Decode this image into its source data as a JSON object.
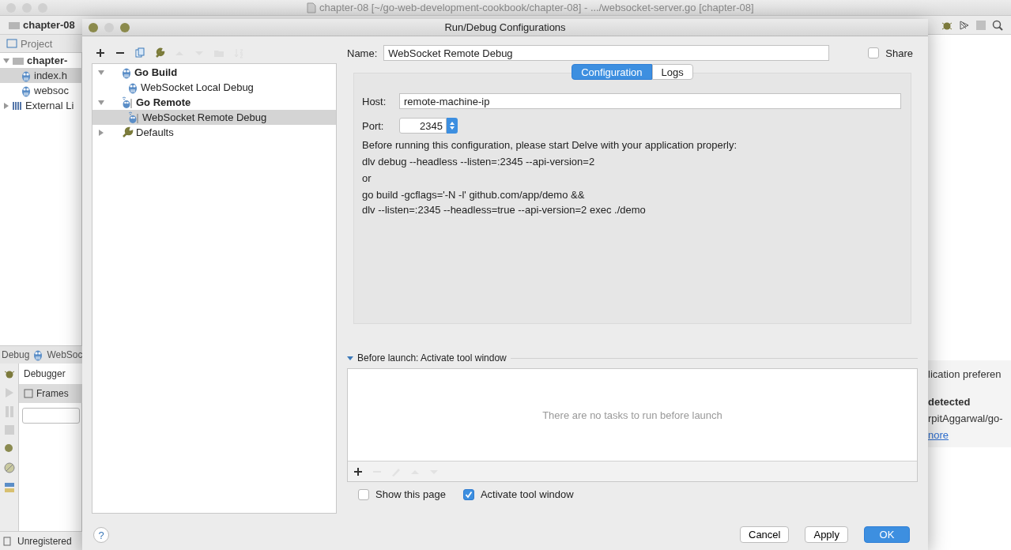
{
  "app_window": {
    "title": "chapter-08 [~/go-web-development-cookbook/chapter-08] - .../websocket-server.go [chapter-08]",
    "breadcrumb": "chapter-08",
    "project_tab": "Project",
    "project_tree": [
      {
        "label": "chapter-",
        "expanded": true,
        "children": [
          {
            "label": "index.h",
            "selected": true
          },
          {
            "label": "websoc",
            "selected": false
          }
        ]
      },
      {
        "label": "External Li",
        "expanded": false
      }
    ],
    "debug_panel": {
      "title": "Debug",
      "session": "WebSoc",
      "tab": "Debugger",
      "frames_label": "Frames"
    },
    "status_bar": "Unregistered",
    "notification": {
      "line_1": "lication preferen",
      "title": "detected",
      "line_2": "rpitAggarwal/go-",
      "link": "nore"
    }
  },
  "dialog": {
    "title": "Run/Debug Configurations",
    "toolbar": [
      {
        "kind": "add",
        "disabled": false
      },
      {
        "kind": "remove",
        "disabled": false
      },
      {
        "kind": "copy",
        "disabled": false
      },
      {
        "kind": "edit",
        "disabled": false
      },
      {
        "kind": "up",
        "disabled": true
      },
      {
        "kind": "down",
        "disabled": true
      },
      {
        "kind": "folder",
        "disabled": true
      },
      {
        "kind": "sort",
        "disabled": true
      }
    ],
    "config_tree": [
      {
        "label": "Go Build",
        "kind": "build",
        "expanded": true,
        "children": [
          {
            "label": "WebSocket Local Debug",
            "kind": "build",
            "selected": false
          }
        ]
      },
      {
        "label": "Go Remote",
        "kind": "remote",
        "expanded": true,
        "children": [
          {
            "label": "WebSocket Remote Debug",
            "kind": "remote",
            "selected": true
          }
        ]
      },
      {
        "label": "Defaults",
        "kind": "defaults",
        "expanded": false
      }
    ],
    "name": {
      "label": "Name:",
      "value": "WebSocket Remote Debug"
    },
    "share": {
      "label": "Share",
      "checked": false
    },
    "tabs": [
      {
        "label": "Configuration",
        "selected": true
      },
      {
        "label": "Logs",
        "selected": false
      }
    ],
    "host": {
      "label": "Host:",
      "value": "remote-machine-ip"
    },
    "port": {
      "label": "Port:",
      "value": "2345"
    },
    "instructions": [
      "Before running this configuration, please start Delve with your application properly:",
      "dlv debug --headless --listen=:2345 --api-version=2",
      "or",
      "go build -gcflags='-N -l' github.com/app/demo &&",
      "dlv --listen=:2345 --headless=true --api-version=2 exec ./demo"
    ],
    "before_launch": {
      "title": "Before launch: Activate tool window",
      "expanded": true,
      "empty_text": "There are no tasks to run before launch",
      "toolbar": [
        {
          "kind": "add",
          "disabled": false
        },
        {
          "kind": "remove",
          "disabled": true
        },
        {
          "kind": "edit",
          "disabled": true
        },
        {
          "kind": "up",
          "disabled": true
        },
        {
          "kind": "down",
          "disabled": true
        }
      ]
    },
    "options": [
      {
        "label": "Show this page",
        "checked": false
      },
      {
        "label": "Activate tool window",
        "checked": true
      }
    ],
    "help": "?",
    "buttons": [
      {
        "label": "Cancel",
        "default": false
      },
      {
        "label": "Apply",
        "default": false
      },
      {
        "label": "OK",
        "default": true
      }
    ]
  }
}
